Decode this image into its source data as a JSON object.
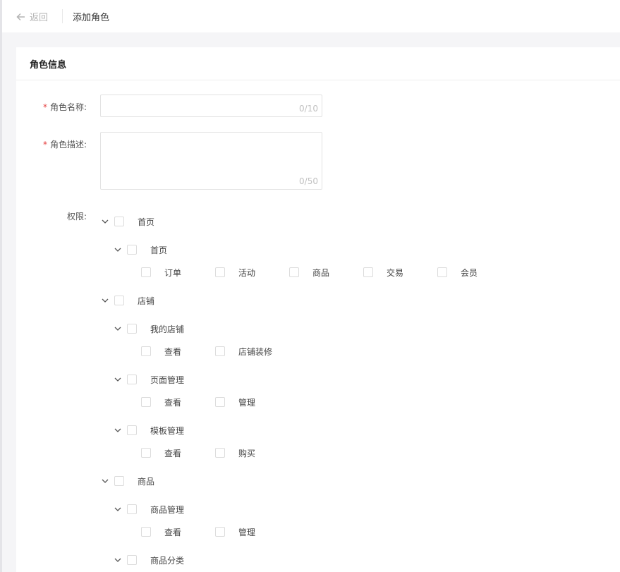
{
  "header": {
    "back_label": "返回",
    "title": "添加角色"
  },
  "section_title": "角色信息",
  "form": {
    "name_label": "角色名称:",
    "name_counter": "0/10",
    "desc_label": "角色描述:",
    "desc_counter": "0/50",
    "perm_label": "权限:",
    "required_mark": "*"
  },
  "permissions": {
    "home": {
      "label": "首页",
      "sub": {
        "label": "首页",
        "items": [
          "订单",
          "活动",
          "商品",
          "交易",
          "会员"
        ]
      }
    },
    "shop": {
      "label": "店铺",
      "my_shop": {
        "label": "我的店铺",
        "items": [
          "查看",
          "店铺装修"
        ]
      },
      "page_mgmt": {
        "label": "页面管理",
        "items": [
          "查看",
          "管理"
        ]
      },
      "template_mgmt": {
        "label": "模板管理",
        "items": [
          "查看",
          "购买"
        ]
      }
    },
    "goods": {
      "label": "商品",
      "goods_mgmt": {
        "label": "商品管理",
        "items": [
          "查看",
          "管理"
        ]
      },
      "goods_category": {
        "label": "商品分类"
      }
    }
  }
}
